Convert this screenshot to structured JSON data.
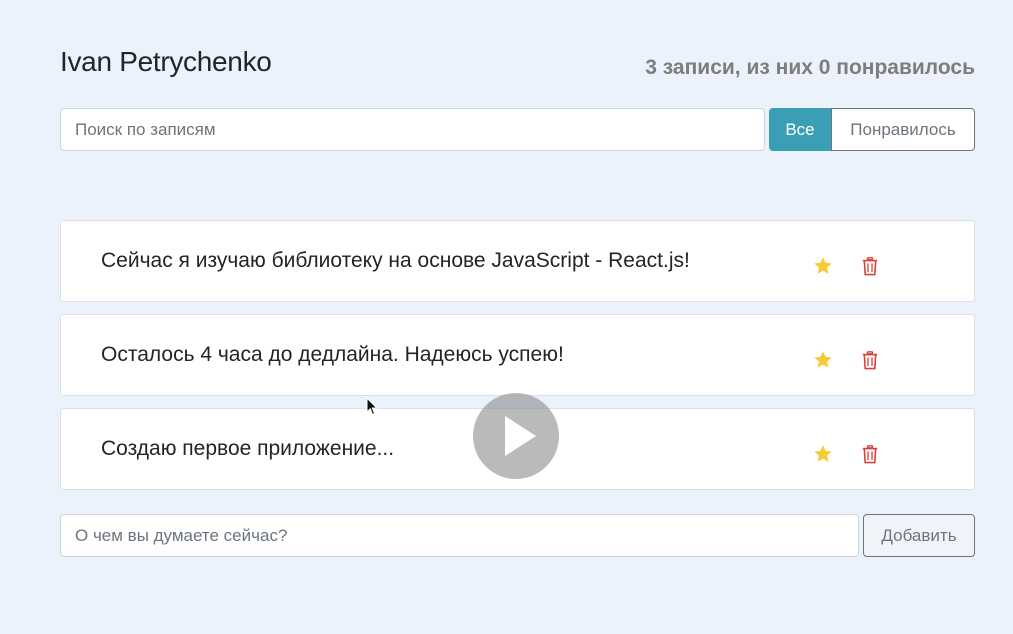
{
  "header": {
    "title": "Ivan Petrychenko",
    "stats": "3 записи, из них 0 понравилось"
  },
  "search": {
    "placeholder": "Поиск по записям",
    "value": ""
  },
  "filter": {
    "all_label": "Все",
    "liked_label": "Понравилось",
    "active": "all"
  },
  "posts": [
    {
      "text": "Сейчас я изучаю библиотеку на основе JavaScript - React.js!",
      "important": true,
      "liked": false
    },
    {
      "text": "Осталось 4 часа до дедлайна. Надеюсь успею!",
      "important": true,
      "liked": false
    },
    {
      "text": "Создаю первое приложение...",
      "important": true,
      "liked": false
    }
  ],
  "add_form": {
    "placeholder": "О чем вы думаете сейчас?",
    "value": "",
    "button_label": "Добавить"
  },
  "colors": {
    "background": "#ebf2fb",
    "primary": "#3a9fb5",
    "star": "#f5cc33",
    "trash": "#d9403a",
    "stats_text": "#7d7d7d"
  },
  "icons": {
    "star": "star-icon",
    "trash": "trash-icon",
    "play": "play-icon",
    "cursor": "mouse-pointer-icon"
  }
}
